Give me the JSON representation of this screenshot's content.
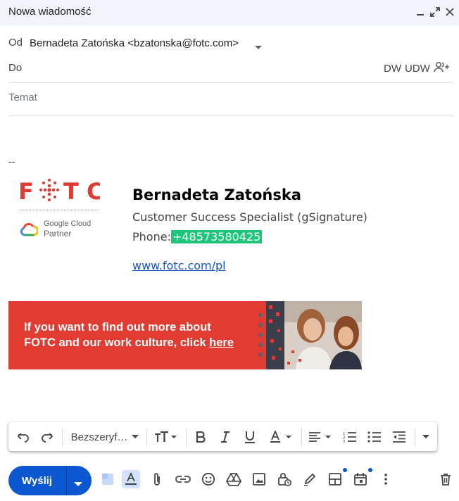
{
  "window": {
    "title": "Nowa wiadomość"
  },
  "header": {
    "from_label": "Od",
    "from_value": "Bernadeta Zatońska <bzatonska@fotc.com>",
    "to_label": "Do",
    "cc_label": "DW",
    "bcc_label": "UDW",
    "subject_placeholder": "Temat",
    "subject_value": ""
  },
  "signature": {
    "separator": "--",
    "logo_text": "FOTC",
    "partner_brand": "Google Cloud",
    "partner_label": "Partner",
    "name": "Bernadeta Zatońska",
    "role": "Customer Success Specialist (gSignature)",
    "phone_label": "Phone:",
    "phone": "+48573580425",
    "website": "www.fotc.com/pl"
  },
  "banner": {
    "line1": "If you want to find out more about",
    "line2_prefix": "FOTC and our work culture, click ",
    "line2_link": "here",
    "background": "#e23b31"
  },
  "format_toolbar": {
    "font_family": "Bezszeryf…",
    "icons": [
      "undo-icon",
      "redo-icon",
      "text-size-icon",
      "bold-icon",
      "italic-icon",
      "underline-icon",
      "text-color-icon",
      "align-icon",
      "numbered-list-icon",
      "bulleted-list-icon",
      "indent-less-icon",
      "more-formatting-icon"
    ]
  },
  "bottom_toolbar": {
    "send_label": "Wyślij",
    "accent": "#0b57d0",
    "icons": [
      "formatting-options-icon",
      "text-format-icon",
      "attach-icon",
      "link-icon",
      "emoji-icon",
      "drive-icon",
      "photo-icon",
      "confidential-icon",
      "signature-icon",
      "layouts-icon",
      "schedule-icon",
      "more-options-icon",
      "discard-icon"
    ]
  }
}
